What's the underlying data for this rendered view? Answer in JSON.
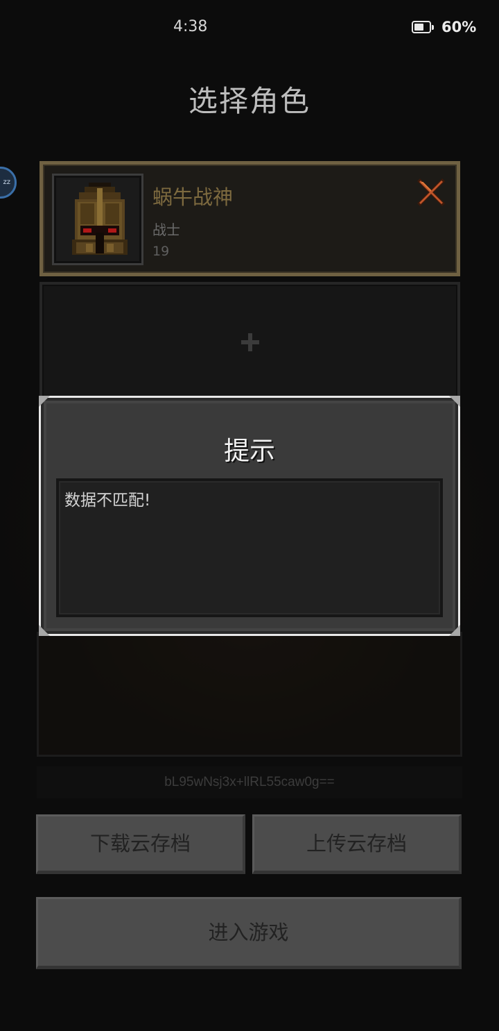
{
  "status_bar": {
    "time": "4:38",
    "battery": "60%"
  },
  "page": {
    "title": "选择角色"
  },
  "floating_bubble": {
    "label": "zz"
  },
  "character_slots": [
    {
      "name": "蜗牛战神",
      "class": "战士",
      "level": "19",
      "selected": true
    }
  ],
  "save_code": "bL95wNsj3x+llRL55caw0g==",
  "buttons": {
    "download": "下载云存档",
    "upload": "上传云存档",
    "enter_game": "进入游戏"
  },
  "dialog": {
    "title": "提示",
    "message": "数据不匹配!"
  },
  "colors": {
    "accent_gold": "#7d6a3f",
    "delete_red": "#c0552a"
  },
  "icons": [
    "warrior-helmet-portrait",
    "delete-x-icon",
    "add-slot-plus-icon",
    "battery-icon"
  ]
}
